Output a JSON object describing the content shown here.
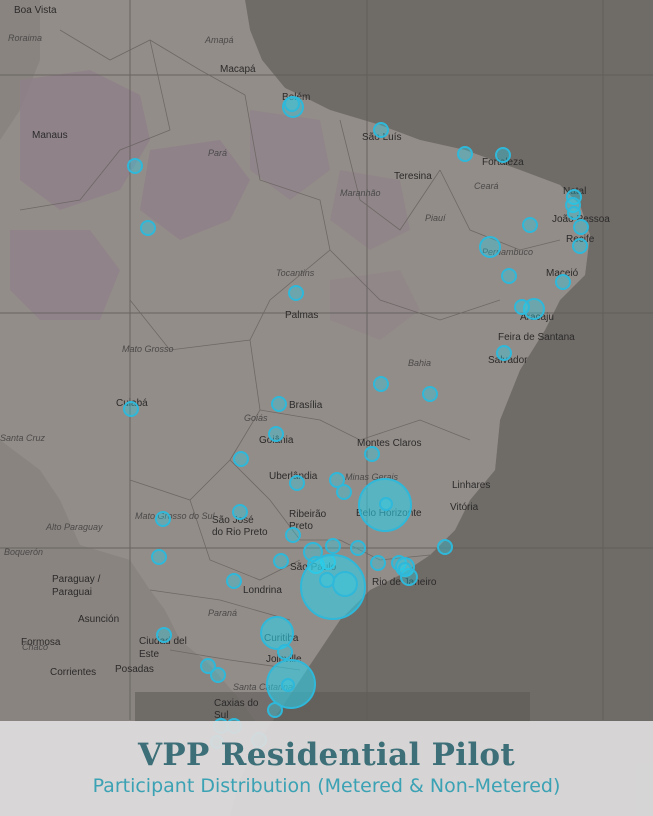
{
  "title": "VPP Residential Pilot",
  "subtitle": "Participant Distribution (Metered & Non-Metered)",
  "colors": {
    "marker": "#29d5ee",
    "marker_stroke": "#2fb8d9",
    "ocean": "#6f6b67",
    "land": "#8a8480",
    "brazil": "#938d89",
    "caption_bg": "#dedddd"
  },
  "places": [
    {
      "name": "Boa Vista"
    },
    {
      "name": "Macapá"
    },
    {
      "name": "Manaus"
    },
    {
      "name": "Belém"
    },
    {
      "name": "São Luís"
    },
    {
      "name": "Fortaleza"
    },
    {
      "name": "Teresina"
    },
    {
      "name": "Natal"
    },
    {
      "name": "João Pessoa"
    },
    {
      "name": "Recife"
    },
    {
      "name": "Maceió"
    },
    {
      "name": "Aracaju"
    },
    {
      "name": "Palmas"
    },
    {
      "name": "Feira de Santana"
    },
    {
      "name": "Salvador"
    },
    {
      "name": "Cuiabá"
    },
    {
      "name": "Brasília"
    },
    {
      "name": "Goiânia"
    },
    {
      "name": "Montes Claros"
    },
    {
      "name": "Uberlândia"
    },
    {
      "name": "Linhares"
    },
    {
      "name": "Vitória"
    },
    {
      "name": "Belo Horizonte"
    },
    {
      "name": "Ribeirão Preto"
    },
    {
      "name": "São José do Rio Preto"
    },
    {
      "name": "Rio de Janeiro"
    },
    {
      "name": "São Paulo"
    },
    {
      "name": "Paraguay / Paraguai"
    },
    {
      "name": "Asunción"
    },
    {
      "name": "Londrina"
    },
    {
      "name": "Curitiba"
    },
    {
      "name": "Formosa"
    },
    {
      "name": "Ciudad del Este"
    },
    {
      "name": "Corrientes"
    },
    {
      "name": "Posadas"
    },
    {
      "name": "Joinville"
    },
    {
      "name": "Caxias do Sul"
    }
  ],
  "regions": [
    {
      "name": "Roraima"
    },
    {
      "name": "Amapá"
    },
    {
      "name": "Pará"
    },
    {
      "name": "Maranhão"
    },
    {
      "name": "Ceará"
    },
    {
      "name": "Piauí"
    },
    {
      "name": "Pernambuco"
    },
    {
      "name": "Tocantins"
    },
    {
      "name": "Mato Grosso"
    },
    {
      "name": "Bahia"
    },
    {
      "name": "Goiás"
    },
    {
      "name": "Minas Gerais"
    },
    {
      "name": "Mato Grosso do Sul"
    },
    {
      "name": "Alto Paraguay"
    },
    {
      "name": "Boquerón"
    },
    {
      "name": "Santa Cruz"
    },
    {
      "name": "Paraná"
    },
    {
      "name": "Chaco"
    },
    {
      "name": "Santa Catarina"
    }
  ]
}
